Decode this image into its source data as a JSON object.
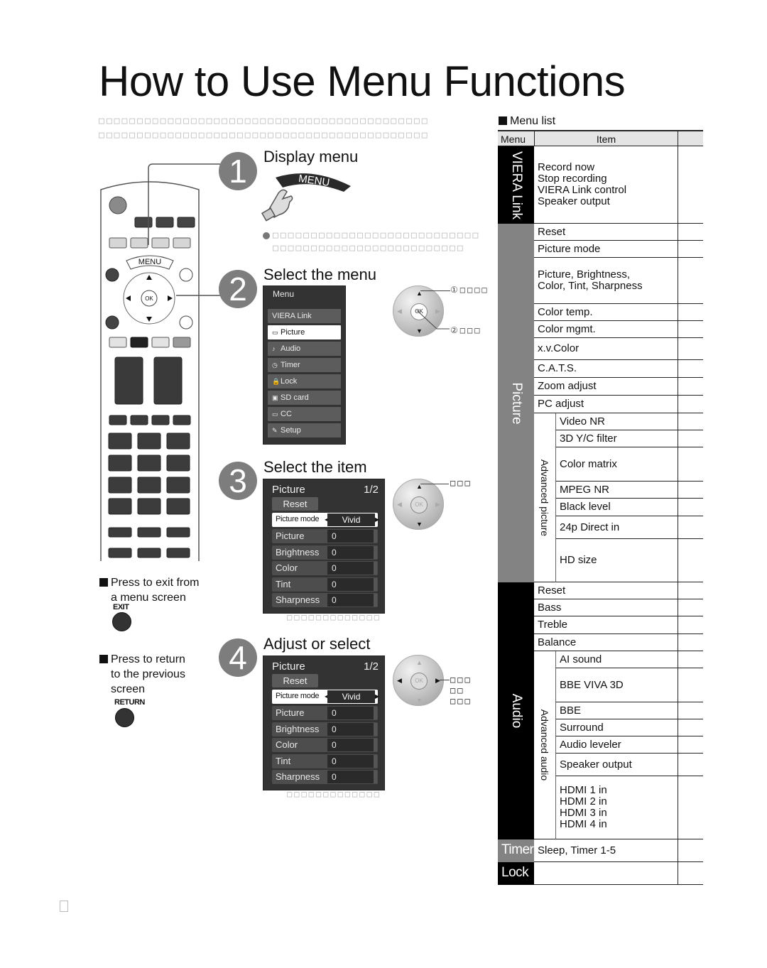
{
  "page": {
    "title": "How to Use Menu Functions",
    "intro_line_1": "□□□□□□□□□□□□□□□□□□□□□□□□□□□□□□□□□□□□□□□□□□□",
    "intro_line_2": "□□□□□□□□□□□□□□□□□□□□□□□□□□□□□□□□□□□□□□□□□□□",
    "page_marker": ""
  },
  "remote": {
    "menu_button_label": "MENU",
    "ok_label": "OK"
  },
  "steps": [
    {
      "number": "1",
      "title": "Display menu",
      "button_label": "MENU",
      "note_line_1": "□□□□□□□□□□□□□□□□□□□□□□□□□□□",
      "note_line_2": "□□□□□□□□□□□□□□□□□□□□□□□□□"
    },
    {
      "number": "2",
      "title": "Select the menu",
      "osd": {
        "header": "Menu",
        "items": [
          {
            "label": "VIERA Link",
            "icon": "",
            "selected": false
          },
          {
            "label": "Picture",
            "icon": "▭",
            "selected": true
          },
          {
            "label": "Audio",
            "icon": "♪",
            "selected": false
          },
          {
            "label": "Timer",
            "icon": "◷",
            "selected": false
          },
          {
            "label": "Lock",
            "icon": "🔒",
            "selected": false
          },
          {
            "label": "SD card",
            "icon": "▣",
            "selected": false
          },
          {
            "label": "CC",
            "icon": "▭",
            "selected": false
          },
          {
            "label": "Setup",
            "icon": "✎",
            "selected": false
          }
        ]
      },
      "callout_1": "①□□□□",
      "callout_2": "②□□□"
    },
    {
      "number": "3",
      "title": "Select the item",
      "callout": "□□□",
      "caption": "□□□□□□□□□□□□□"
    },
    {
      "number": "4",
      "title": "Adjust or select",
      "callout_1": "□□□",
      "callout_2": "□□",
      "callout_3": "□□□",
      "caption": "□□□□□□□□□□□□□"
    }
  ],
  "picture_screen": {
    "title": "Picture",
    "page": "1/2",
    "reset_label": "Reset",
    "mode_label": "Picture mode",
    "mode_value": "Vivid",
    "rows": [
      {
        "label": "Picture",
        "value": "0"
      },
      {
        "label": "Brightness",
        "value": "0"
      },
      {
        "label": "Color",
        "value": "0"
      },
      {
        "label": "Tint",
        "value": "0"
      },
      {
        "label": "Sharpness",
        "value": "0"
      }
    ]
  },
  "side_notes": {
    "exit_text_1": "Press to exit from",
    "exit_text_2": "a menu screen",
    "exit_button": "EXIT",
    "return_text_1": "Press to return",
    "return_text_2": "to the previous",
    "return_text_3": "screen",
    "return_button": "RETURN"
  },
  "menu_list": {
    "title": "Menu list",
    "header_menu": "Menu",
    "header_item": "Item",
    "categories": {
      "viera_link": "VIERA Link",
      "picture": "Picture",
      "advanced_picture": "Advanced picture",
      "audio": "Audio",
      "advanced_audio": "Advanced audio",
      "timer": "Timer",
      "lock": "Lock"
    },
    "viera_link_items": [
      "Record now",
      "Stop recording",
      "VIERA Link control",
      "Speaker output"
    ],
    "picture_items": [
      "Reset",
      "Picture mode",
      "Picture, Brightness,",
      "Color, Tint, Sharpness",
      "Color temp.",
      "Color mgmt.",
      "x.v.Color",
      "C.A.T.S.",
      "Zoom adjust",
      "PC adjust"
    ],
    "advanced_picture_items": [
      "Video NR",
      "3D Y/C filter",
      "Color matrix",
      "MPEG NR",
      "Black level",
      "24p Direct in",
      "HD size"
    ],
    "audio_items": [
      "Reset",
      "Bass",
      "Treble",
      "Balance"
    ],
    "advanced_audio_items": [
      "AI sound",
      "BBE VIVA 3D",
      "BBE",
      "Surround",
      "Audio leveler",
      "Speaker output",
      "HDMI 1 in",
      "HDMI 2 in",
      "HDMI 3 in",
      "HDMI 4 in"
    ],
    "timer_items": [
      "Sleep, Timer 1-5"
    ],
    "lock_items": []
  }
}
